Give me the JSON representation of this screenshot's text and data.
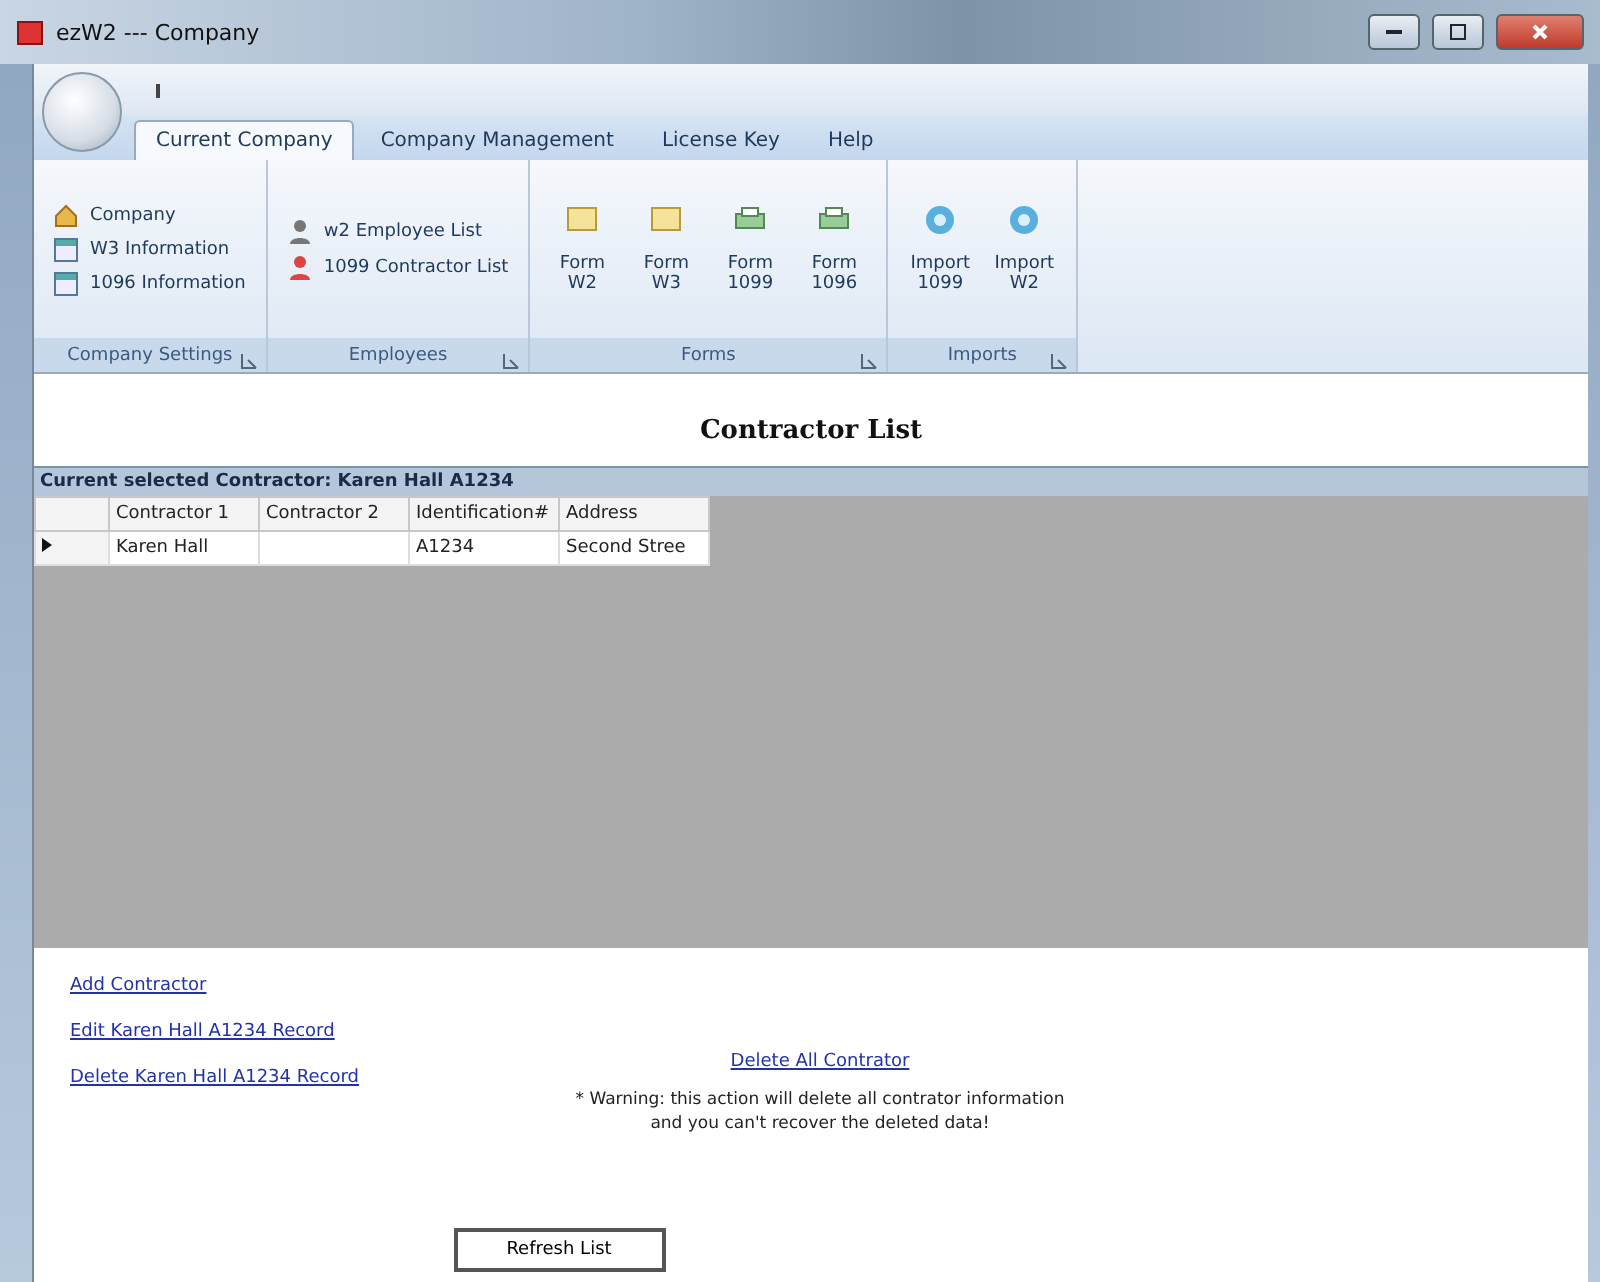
{
  "window": {
    "title": "ezW2 --- Company"
  },
  "tabs": [
    {
      "label": "Current Company",
      "selected": true
    },
    {
      "label": "Company Management",
      "selected": false
    },
    {
      "label": "License Key",
      "selected": false
    },
    {
      "label": "Help",
      "selected": false
    }
  ],
  "ribbon_groups": [
    {
      "label": "Company Settings",
      "items": [
        {
          "kind": "house",
          "label": "Company"
        },
        {
          "kind": "sheet",
          "label": "W3 Information"
        },
        {
          "kind": "sheet",
          "label": "1096 Information"
        }
      ]
    },
    {
      "label": "Employees",
      "items": [
        {
          "kind": "employee",
          "label": "w2 Employee List"
        },
        {
          "kind": "contractor",
          "label": "1099 Contractor List"
        }
      ]
    },
    {
      "label": "Forms",
      "items": [
        {
          "kind": "note",
          "label": "Form W2"
        },
        {
          "kind": "note",
          "label": "Form W3"
        },
        {
          "kind": "printer",
          "label": "Form 1099"
        },
        {
          "kind": "printer",
          "label": "Form 1096"
        }
      ]
    },
    {
      "label": "Imports",
      "items": [
        {
          "kind": "disc",
          "label": "Import 1099"
        },
        {
          "kind": "disc",
          "label": "Import W2"
        }
      ]
    }
  ],
  "page_title": "Contractor List",
  "selection_bar": "Current selected Contractor: Karen Hall A1234",
  "table": {
    "columns": [
      "Contractor 1",
      "Contractor 2",
      "Identification#",
      "Address"
    ],
    "rows": [
      {
        "selected": true,
        "cells": [
          "Karen Hall",
          "",
          "A1234",
          "Second Stree"
        ]
      }
    ]
  },
  "links": [
    "Add Contractor",
    "Edit Karen Hall A1234 Record",
    "Delete Karen Hall A1234 Record"
  ],
  "delete_all": {
    "link": "Delete All Contrator",
    "warning": [
      "* Warning: this action will delete all contrator information",
      "and you can't recover the deleted data!"
    ]
  },
  "refresh_button": "Refresh List"
}
